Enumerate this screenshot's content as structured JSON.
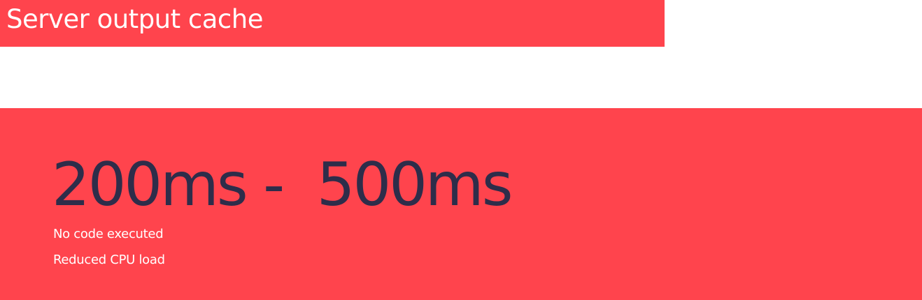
{
  "header": {
    "title": "Server output cache"
  },
  "main": {
    "timing_range": "200ms -  500ms",
    "points": [
      "No code executed",
      "Reduced CPU load"
    ]
  },
  "colors": {
    "accent": "#ff444d",
    "timing_text": "#2e2d4a",
    "light_text": "#ffffff",
    "background": "#ffffff"
  }
}
